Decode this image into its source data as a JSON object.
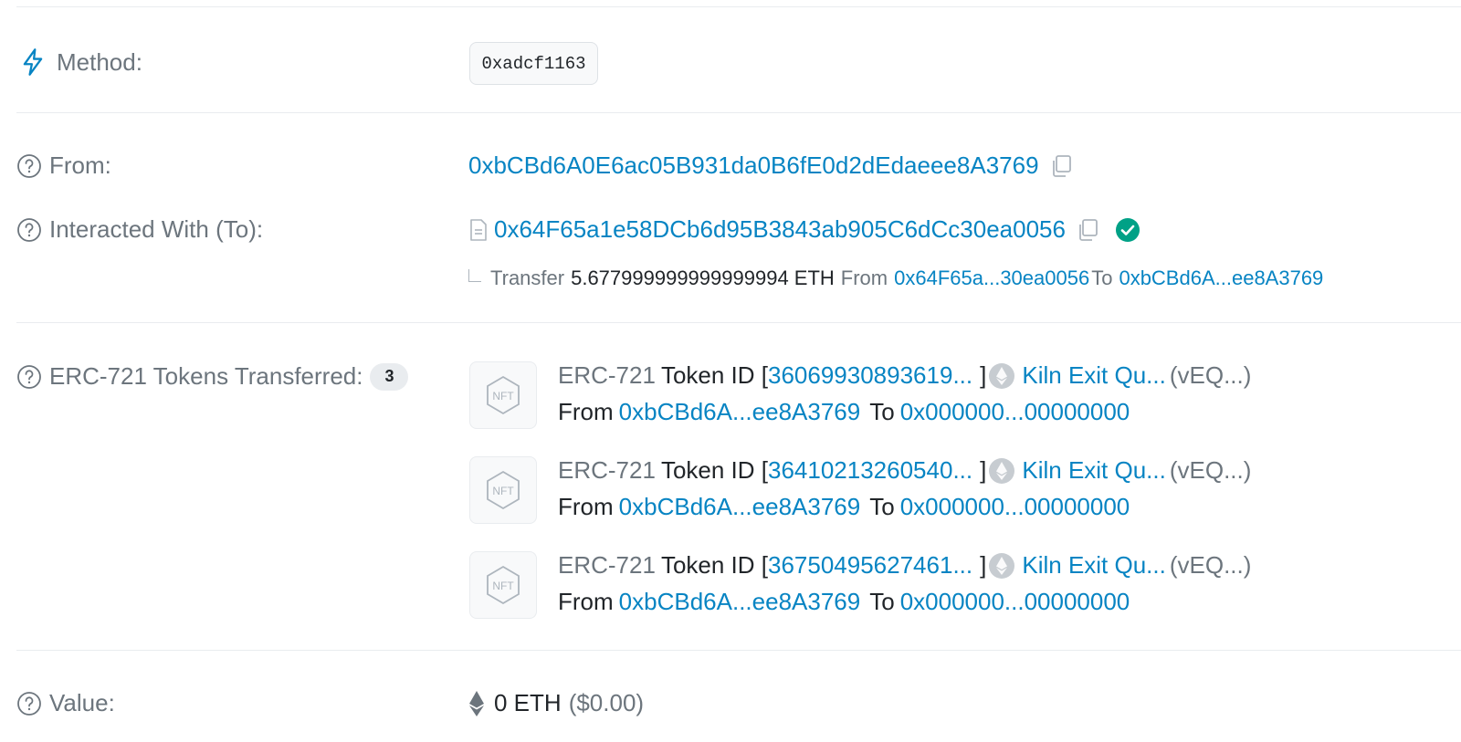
{
  "method": {
    "label": "Method:",
    "value": "0xadcf1163"
  },
  "from": {
    "label": "From:",
    "address": "0xbCBd6A0E6ac05B931da0B6fE0d2dEdaeee8A3769"
  },
  "interacted_with": {
    "label": "Interacted With (To):",
    "address": "0x64F65a1e58DCb6d95B3843ab905C6dCc30ea0056",
    "internal_transfer": {
      "transfer_word": "Transfer",
      "amount": "5.677999999999999994 ETH",
      "from_word": "From",
      "from_address": "0x64F65a...30ea0056",
      "to_word": "To",
      "to_address": "0xbCBd6A...ee8A3769"
    }
  },
  "erc721": {
    "label": "ERC-721 Tokens Transferred:",
    "count": "3",
    "tokens": [
      {
        "standard": "ERC-721",
        "token_id_label": "Token ID [",
        "token_id": "36069930893619...",
        "bracket_close": "]",
        "token_name": "Kiln Exit Qu...",
        "symbol": "(vEQ...)",
        "from_word": "From",
        "from_address": "0xbCBd6A...ee8A3769",
        "to_word": "To",
        "to_address": "0x000000...00000000"
      },
      {
        "standard": "ERC-721",
        "token_id_label": "Token ID [",
        "token_id": "36410213260540...",
        "bracket_close": "]",
        "token_name": "Kiln Exit Qu...",
        "symbol": "(vEQ...)",
        "from_word": "From",
        "from_address": "0xbCBd6A...ee8A3769",
        "to_word": "To",
        "to_address": "0x000000...00000000"
      },
      {
        "standard": "ERC-721",
        "token_id_label": "Token ID [",
        "token_id": "36750495627461...",
        "bracket_close": "]",
        "token_name": "Kiln Exit Qu...",
        "symbol": "(vEQ...)",
        "from_word": "From",
        "from_address": "0xbCBd6A...ee8A3769",
        "to_word": "To",
        "to_address": "0x000000...00000000"
      }
    ]
  },
  "value": {
    "label": "Value:",
    "amount": "0 ETH",
    "usd": "($0.00)"
  },
  "colors": {
    "link": "#0784c3",
    "muted": "#6c757d",
    "success": "#00a186"
  }
}
